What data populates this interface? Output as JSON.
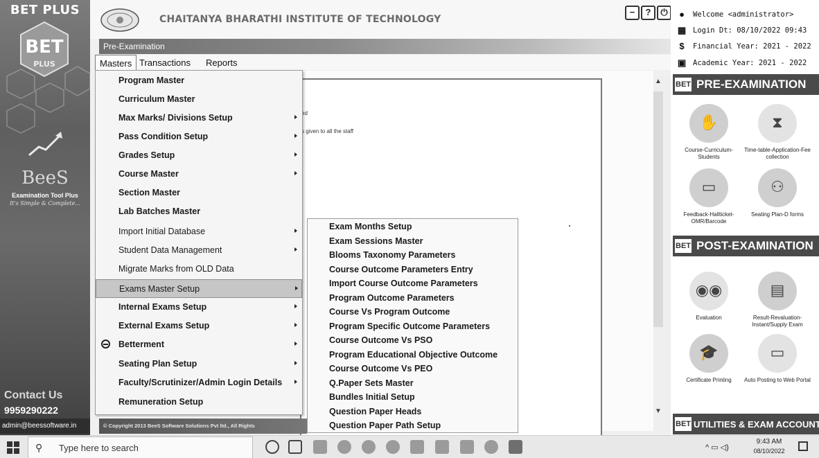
{
  "sidebar": {
    "brand": "BET PLUS",
    "product": "BeeS",
    "product_tool": "Examination Tool Plus",
    "tagline": "It's Simple & Complete...",
    "contact_label": "Contact Us",
    "phone": "9959290222",
    "email": "admin@beessoftware.in"
  },
  "header": {
    "institute": "CHAITANYA BHARATHI INSTITUTE OF TECHNOLOGY",
    "module": "Pre-Examination",
    "buttons": [
      "minimize-icon",
      "help-icon",
      "power-icon"
    ],
    "help_glyph": "?",
    "minus_glyph": "−",
    "power_glyph": "⏻"
  },
  "menubar": {
    "items": [
      "Masters",
      "Transactions",
      "Reports"
    ]
  },
  "masters_menu": {
    "items": [
      {
        "label": "Program Master",
        "submenu": false
      },
      {
        "label": "Curriculum Master",
        "submenu": false
      },
      {
        "label": "Max Marks/ Divisions Setup",
        "submenu": true
      },
      {
        "label": "Pass Condition Setup",
        "submenu": true
      },
      {
        "label": "Grades Setup",
        "submenu": true
      },
      {
        "label": "Course Master",
        "submenu": true
      },
      {
        "label": "Section Master",
        "submenu": false
      },
      {
        "label": "Lab Batches Master",
        "submenu": false
      },
      {
        "label": "Import Initial Database",
        "submenu": true
      },
      {
        "label": "Student Data Management",
        "submenu": true
      },
      {
        "label": "Migrate Marks from OLD Data",
        "submenu": false
      },
      {
        "label": "Exams Master Setup",
        "submenu": true,
        "highlighted": true
      },
      {
        "label": "Internal Exams Setup",
        "submenu": true
      },
      {
        "label": "External Exams Setup",
        "submenu": true
      },
      {
        "label": "Betterment",
        "submenu": true,
        "icon": "minus-circle-icon"
      },
      {
        "label": "Seating Plan Setup",
        "submenu": true
      },
      {
        "label": "Faculty/Scrutinizer/Admin Login Details",
        "submenu": true
      },
      {
        "label": "Remuneration Setup",
        "submenu": false
      }
    ]
  },
  "exam_submenu": {
    "items": [
      "Exam Months Setup",
      "Exam Sessions Master",
      "Blooms Taxonomy Parameters",
      "Course Outcome Parameters Entry",
      "Import Course Outcome Parameters",
      "Program Outcome Parameters",
      "Course Vs Program Outcome",
      "Program Specific Outcome Parameters",
      "Course Outcome Vs PSO",
      "Program Educational Objective Outcome",
      "Course Outcome Vs PEO",
      "Q.Paper Sets Master",
      "Bundles Initial Setup",
      "Question Paper Heads",
      "Question Paper Path Setup"
    ]
  },
  "content": {
    "line1": "ed",
    "line2": "s given to all the staff"
  },
  "footer": {
    "copyright": "© Copyright 2013 BeeS Software Solutions Pvt ltd., All Rights"
  },
  "right_panel": {
    "welcome": "Welcome <administrator>",
    "login": "Login Dt: 08/10/2022 09:43",
    "financial_year": "Financial Year: 2021 - 2022",
    "academic_year": "Academic Year: 2021 - 2022",
    "badge": "BET",
    "pre_exam_title": "PRE-EXAMINATION",
    "pre_exam_tiles": [
      "Course-Curriculum-Students",
      "Time-table-Application-Fee collection",
      "Feedback-Hallticket-OMR/Barcode",
      "Seating Plan-D forms"
    ],
    "post_exam_title": "POST-EXAMINATION",
    "post_exam_tiles": [
      "Evaluation",
      "Result-Revaluation-Instant/Supply Exam",
      "Certificate Printing",
      "Auto Posting to Web Portal"
    ],
    "utilities_title": "UTILITIES & EXAM ACCOUNT"
  },
  "taskbar": {
    "search_placeholder": "Type here to search",
    "time": "9:43 AM",
    "date": "08/10/2022"
  },
  "colors": {
    "sidebar": "#5f5f5f",
    "section_header": "#4a4a4a",
    "menu_highlight": "#c6c6c6"
  }
}
